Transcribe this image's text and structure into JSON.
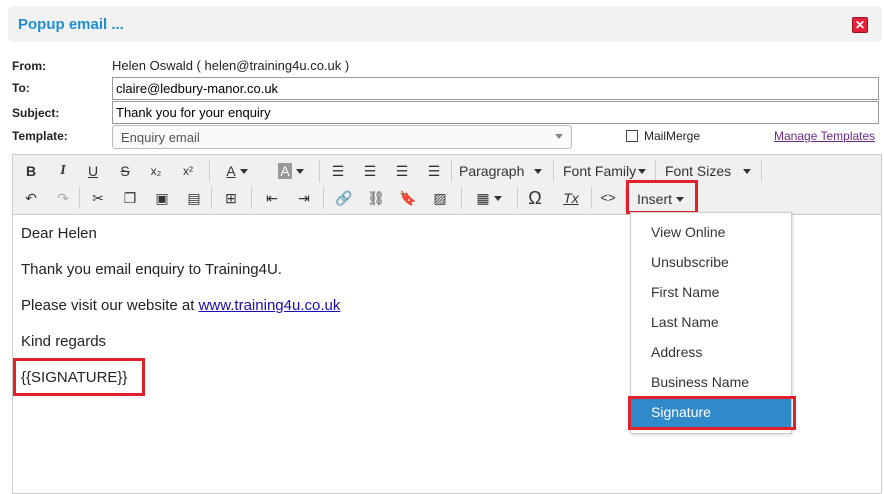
{
  "window": {
    "title": "Popup email ...",
    "close_icon": "close-icon"
  },
  "form": {
    "from_label": "From:",
    "from_value": "Helen Oswald (  helen@training4u.co.uk   )",
    "to_label": "To:",
    "to_value": "claire@ledbury-manor.co.uk",
    "subject_label": "Subject:",
    "subject_value": "Thank you for your enquiry",
    "template_label": "Template:",
    "template_value": "Enquiry email",
    "mailmerge_label": "MailMerge",
    "mailmerge_checked": false,
    "manage_templates": "Manage Templates"
  },
  "toolbar": {
    "paragraph": "Paragraph",
    "font_family": "Font Family",
    "font_sizes": "Font Sizes",
    "insert": "Insert",
    "bold_glyph": "B",
    "italic_glyph": "I",
    "underline_glyph": "U",
    "strike_glyph": "S",
    "sub_glyph": "x₂",
    "sup_glyph": "x²",
    "fontcolor_glyph": "A",
    "bgcolor_glyph": "A",
    "code_glyph": "<>",
    "omega_glyph": "Ω",
    "clear_glyph": "Tx"
  },
  "editor": {
    "line1": "Dear Helen",
    "line2": "Thank you email enquiry to Training4U.",
    "line3_prefix": "Please visit our website at ",
    "line3_link": "www.training4u.co.uk",
    "line4": "Kind regards",
    "line5": "{{SIGNATURE}}"
  },
  "insert_menu": {
    "items": [
      "View Online",
      "Unsubscribe",
      "First Name",
      "Last Name",
      "Address",
      "Business Name",
      "Signature"
    ],
    "selected": "Signature"
  },
  "colors": {
    "accent": "#1f8dcf",
    "highlight": "#e2202c",
    "menu_selected": "#3089c9"
  }
}
